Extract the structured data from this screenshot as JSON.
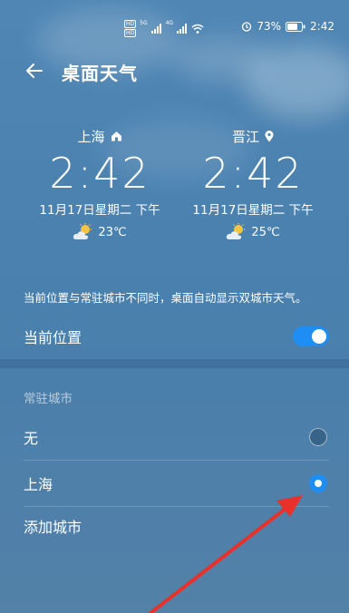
{
  "status_bar": {
    "hd_badge_1": "HD",
    "hd_badge_2": "HD",
    "net_1": "5G",
    "net_2": "4G",
    "battery_percent": "73%",
    "time": "2:42"
  },
  "header": {
    "title": "桌面天气"
  },
  "cities": [
    {
      "name": "上海",
      "marker_icon": "home-icon",
      "time": "2:42",
      "date": "11月17日星期二 下午",
      "temperature": "23℃",
      "weather_icon": "partly-cloudy-icon"
    },
    {
      "name": "晋江",
      "marker_icon": "location-pin-icon",
      "time": "2:42",
      "date": "11月17日星期二 下午",
      "temperature": "25℃",
      "weather_icon": "partly-cloudy-icon"
    }
  ],
  "description": "当前位置与常驻城市不同时，桌面自动显示双城市天气。",
  "current_location": {
    "label": "当前位置",
    "enabled": true
  },
  "resident_city": {
    "section_title": "常驻城市",
    "options": [
      {
        "label": "无",
        "selected": false
      },
      {
        "label": "上海",
        "selected": true
      }
    ],
    "add_city_label": "添加城市"
  },
  "colors": {
    "accent": "#1e8ef5",
    "annotation_arrow": "#e8312a"
  }
}
